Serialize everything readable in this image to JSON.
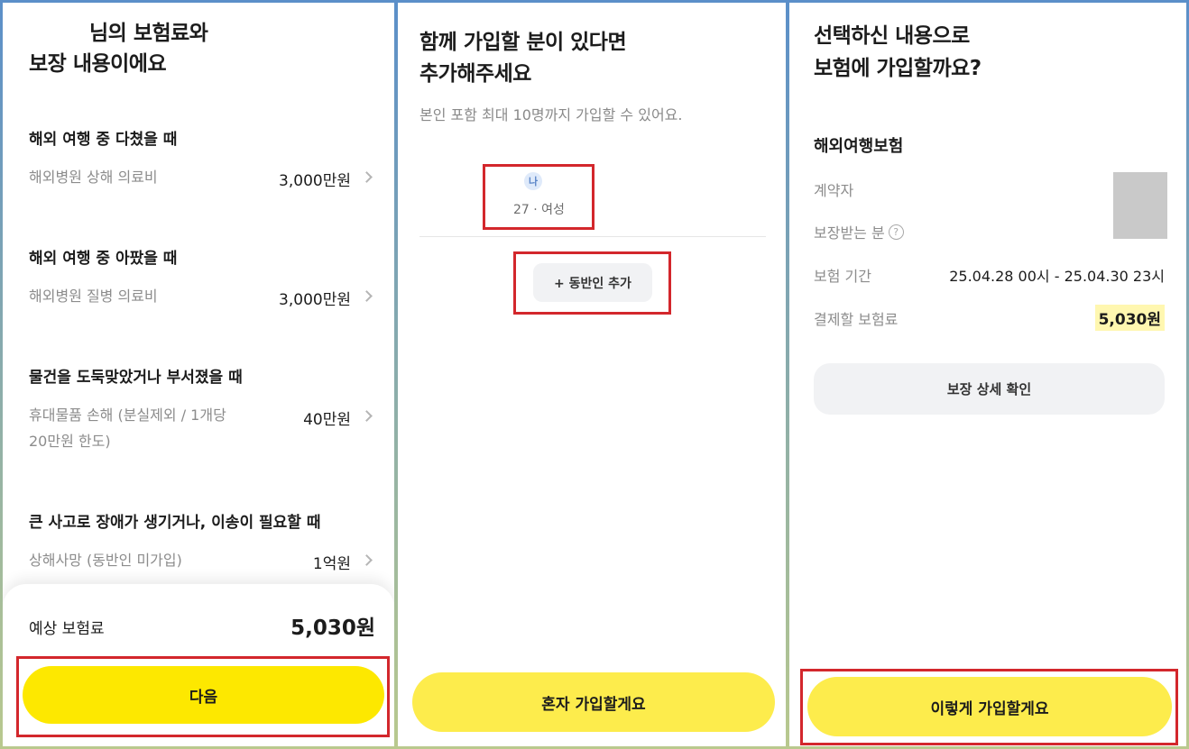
{
  "panel1": {
    "title_line1": "님의 보험료와",
    "title_line2": "보장 내용이에요",
    "sections": [
      {
        "heading": "해외 여행 중 다쳤을 때",
        "item_label": "해외병원 상해 의료비",
        "item_value": "3,000만원"
      },
      {
        "heading": "해외 여행 중 아팠을 때",
        "item_label": "해외병원 질병 의료비",
        "item_value": "3,000만원"
      },
      {
        "heading": "물건을 도둑맞았거나 부서졌을 때",
        "item_label_line1": "휴대물품 손해 (분실제외 / 1개당",
        "item_label_line2": "20만원 한도)",
        "item_value": "40만원"
      },
      {
        "heading": "큰 사고로 장애가 생기거나, 이송이 필요할 때",
        "item_label": "상해사망 (동반인 미가입)",
        "item_value": "1억원"
      }
    ],
    "estimate_label": "예상 보험료",
    "estimate_value": "5,030원",
    "next_button": "다음"
  },
  "panel2": {
    "title_line1": "함께 가입할 분이 있다면",
    "title_line2": "추가해주세요",
    "subtitle": "본인 포함 최대 10명까지 가입할 수 있어요.",
    "member_badge": "나",
    "member_info": "27 · 여성",
    "add_companion": "+ 동반인 추가",
    "solo_button": "혼자 가입할게요"
  },
  "panel3": {
    "title_line1": "선택하신 내용으로",
    "title_line2": "보험에 가입할까요?",
    "insurance_name": "해외여행보험",
    "contractor_label": "계약자",
    "insured_label": "보장받는 분",
    "period_label": "보험 기간",
    "period_value": "25.04.28 00시 - 25.04.30 23시",
    "premium_label": "결제할 보험료",
    "premium_value": "5,030원",
    "coverage_button": "보장 상세 확인",
    "confirm_button": "이렇게 가입할게요"
  },
  "colors": {
    "accent_yellow": "#fde800",
    "soft_yellow": "#fdec4c",
    "highlight_red": "#d3272c"
  },
  "icons": [
    "chevron-right-icon",
    "question-icon"
  ]
}
